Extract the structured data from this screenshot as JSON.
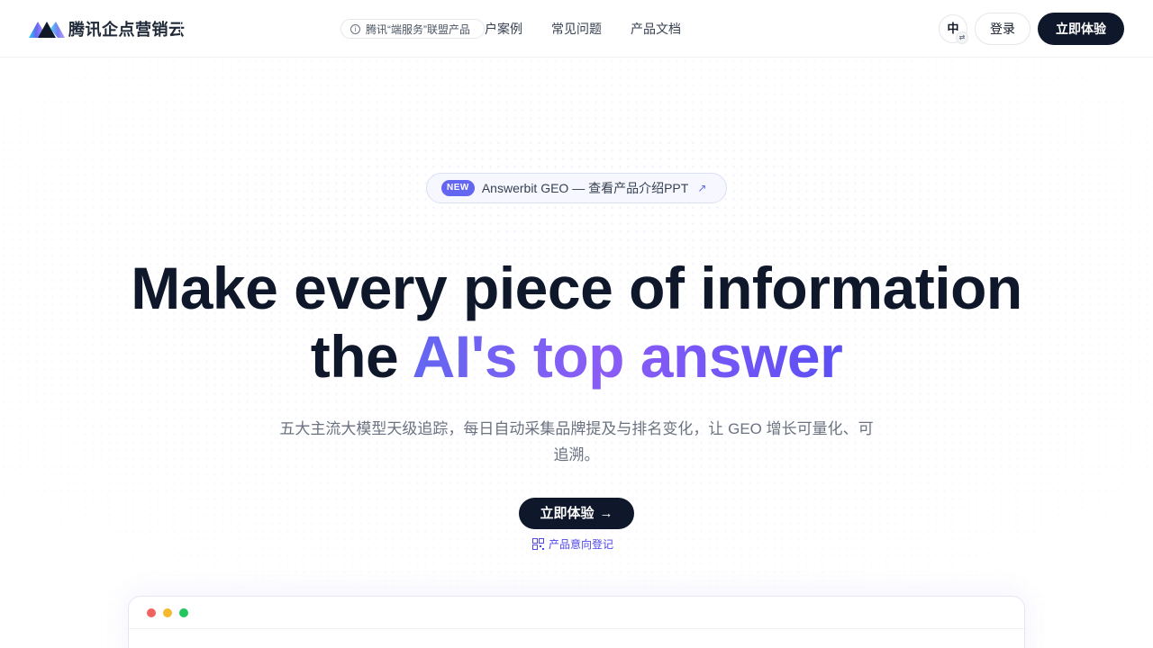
{
  "header": {
    "brand": "腾讯企点营销云",
    "notice": "腾讯“端服务”联盟产品",
    "nav": [
      "户案例",
      "常见问题",
      "产品文档"
    ],
    "lang": "中",
    "login": "登录",
    "try": "立即体验"
  },
  "hero": {
    "badge_tag": "NEW",
    "badge_text": "Answerbit GEO — 查看产品介绍PPT",
    "title_line1": "Make every piece of information",
    "title_line2_prefix": "the ",
    "title_line2_highlight": "AI's top answer",
    "subtitle": "五大主流大模型天级追踪，每日自动采集品牌提及与排名变化，让 GEO 增长可量化、可追溯。",
    "cta": "立即体验",
    "register": "产品意向登记"
  },
  "colors": {
    "primary_dark": "#0f172a",
    "accent": "#6366f1",
    "accent_purple": "#8b5cf6",
    "window_red": "#ef6461",
    "window_yellow": "#f5b82e",
    "window_green": "#22c55e"
  },
  "icons": {
    "notice": "info-icon",
    "badge": "arrow-up-right-icon",
    "cta": "arrow-right-icon",
    "register": "qr-code-icon",
    "lang": "translate-icon"
  }
}
